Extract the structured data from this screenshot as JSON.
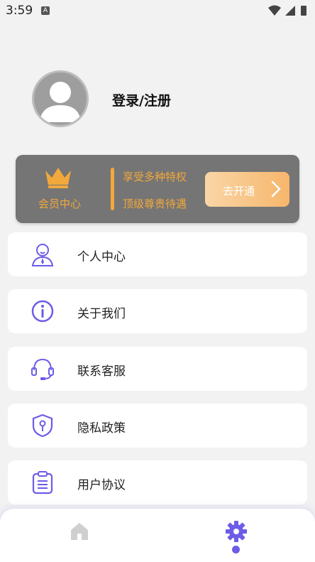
{
  "status": {
    "time": "3:59",
    "a_badge": "A"
  },
  "profile": {
    "login_label": "登录/注册"
  },
  "vip": {
    "title": "会员中心",
    "line1": "享受多种特权",
    "line2": "顶级尊贵待遇",
    "button_label": "去开通",
    "accent_color": "#f2a83a"
  },
  "menu": [
    {
      "label": "个人中心",
      "icon": "person-icon"
    },
    {
      "label": "关于我们",
      "icon": "info-icon"
    },
    {
      "label": "联系客服",
      "icon": "headset-icon"
    },
    {
      "label": "隐私政策",
      "icon": "shield-icon"
    },
    {
      "label": "用户协议",
      "icon": "clipboard-icon"
    }
  ],
  "tabbar": {
    "active_color": "#6c5ce7",
    "inactive_color": "#cfcfcf"
  }
}
